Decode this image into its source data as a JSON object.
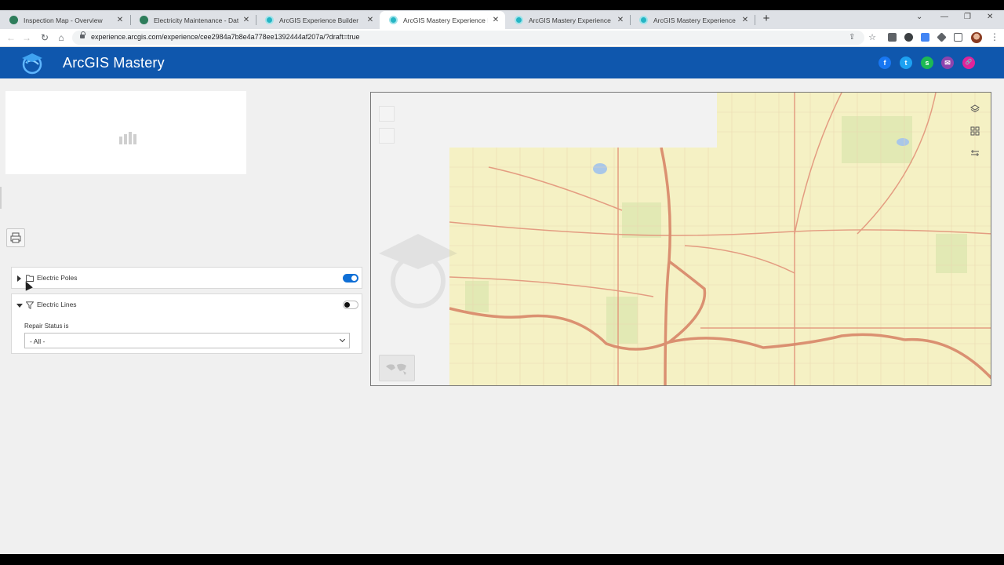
{
  "browser": {
    "tabs": [
      {
        "title": "Inspection Map - Overview",
        "icon": "globe-icon"
      },
      {
        "title": "Electricity Maintenance - Data",
        "icon": "globe-icon"
      },
      {
        "title": "ArcGIS Experience Builder",
        "icon": "experience-builder-icon"
      },
      {
        "title": "ArcGIS Mastery Experience Builder",
        "icon": "experience-builder-icon",
        "active": true
      },
      {
        "title": "ArcGIS Mastery Experience Builder",
        "icon": "experience-builder-icon"
      },
      {
        "title": "ArcGIS Mastery Experience Builder",
        "icon": "experience-builder-icon"
      }
    ],
    "url": "experience.arcgis.com/experience/cee2984a7b8e4a778ee1392444af207a/?draft=true"
  },
  "header": {
    "title": "ArcGIS Mastery",
    "background": "#0f57ad",
    "social": [
      {
        "name": "facebook",
        "glyph": "f",
        "color": "#1877f2"
      },
      {
        "name": "twitter",
        "glyph": "t",
        "color": "#1da1f2"
      },
      {
        "name": "sharepoint",
        "glyph": "s",
        "color": "#1db954"
      },
      {
        "name": "email",
        "glyph": "✉",
        "color": "#8e44ad"
      },
      {
        "name": "link",
        "glyph": "🔗",
        "color": "#e0249a"
      }
    ]
  },
  "layers": {
    "items": [
      {
        "name": "Electric Poles",
        "visible": true,
        "expanded": false
      },
      {
        "name": "Electric Lines",
        "visible": false,
        "expanded": true,
        "filter": {
          "label": "Repair Status is",
          "value": "- All -"
        }
      }
    ]
  },
  "map": {
    "tools_right": [
      "layers-icon",
      "legend-icon",
      "basemap-toggle-icon"
    ],
    "accent_road": "#e2937a",
    "land_color": "#f5f1c4"
  }
}
